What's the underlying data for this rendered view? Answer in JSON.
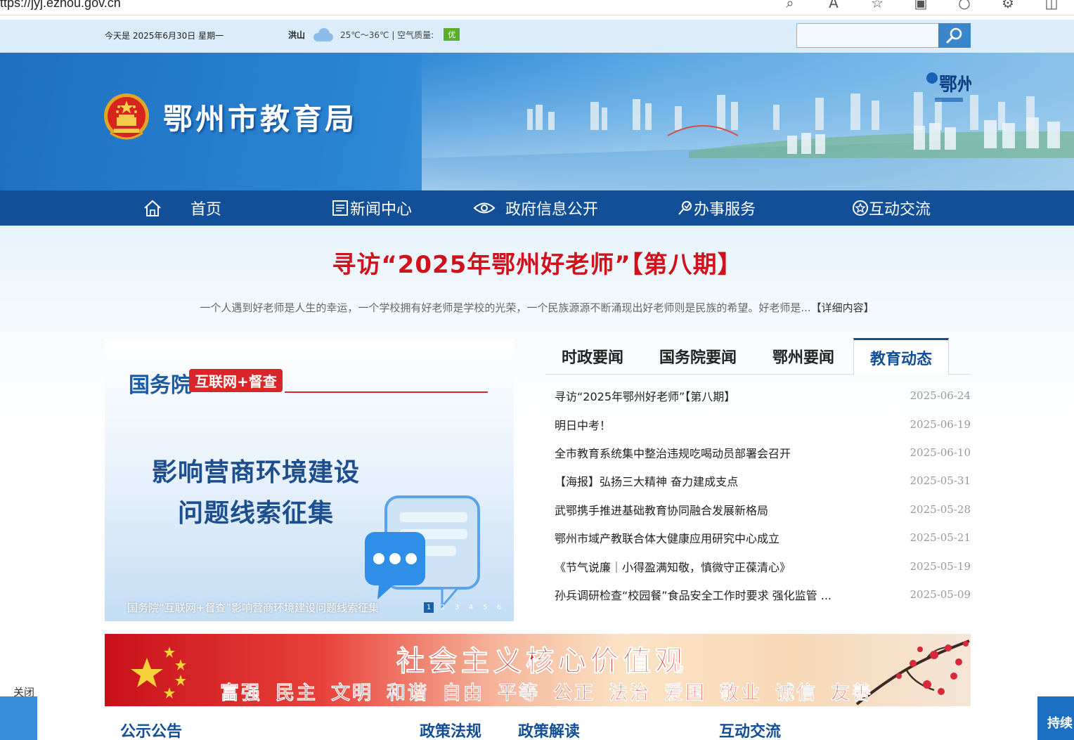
{
  "browser": {
    "url": "ttps://jyj.ezhou.gov.cn"
  },
  "topbar": {
    "date": "今天是 2025年6月30日 星期一",
    "city": "洪山",
    "temperature": "25℃～36℃ | 空气质量:",
    "air_quality": "优",
    "search_placeholder": ""
  },
  "header": {
    "site_title": "鄂州市教育局",
    "corner_logo_text": "鄂州"
  },
  "nav": {
    "items": [
      {
        "label": "首页",
        "icon": "home-icon"
      },
      {
        "label": "新闻中心",
        "icon": "newspaper-icon"
      },
      {
        "label": "政府信息公开",
        "icon": "eye-icon"
      },
      {
        "label": "办事服务",
        "icon": "service-icon"
      },
      {
        "label": "互动交流",
        "icon": "star-circle-icon"
      }
    ]
  },
  "feature": {
    "headline": "寻访“2025年鄂州好老师”【第八期】",
    "summary": "一个人遇到好老师是人生的幸运，一个学校拥有好老师是学校的光荣，一个民族源源不断涌现出好老师则是民族的希望。好老师是...",
    "detail_link": "【详细内容】"
  },
  "slider": {
    "org": "国务院",
    "tag": "互联网+督查",
    "title_line1": "影响营商环境建设",
    "title_line2": "问题线索征集",
    "caption": "国务院“互联网+督查”影响营商环境建设问题线索征集",
    "pages": [
      "1",
      "2",
      "3",
      "4",
      "5",
      "6"
    ],
    "active_page": 1
  },
  "news": {
    "tabs": [
      "时政要闻",
      "国务院要闻",
      "鄂州要闻",
      "教育动态"
    ],
    "active_tab": "教育动态",
    "items": [
      {
        "title": "寻访“2025年鄂州好老师”【第八期】",
        "date": "2025-06-24"
      },
      {
        "title": "明日中考！",
        "date": "2025-06-19"
      },
      {
        "title": "全市教育系统集中整治违规吃喝动员部署会召开",
        "date": "2025-06-10"
      },
      {
        "title": "【海报】弘扬三大精神 奋力建成支点",
        "date": "2025-05-31"
      },
      {
        "title": "武鄂携手推进基础教育协同融合发展新格局",
        "date": "2025-05-28"
      },
      {
        "title": "鄂州市域产教联合体大健康应用研究中心成立",
        "date": "2025-05-21"
      },
      {
        "title": "《节气说廉｜小得盈满知敬，慎微守正葆清心》",
        "date": "2025-05-19"
      },
      {
        "title": "孙兵调研检查“校园餐”食品安全工作时要求 强化监管 ...",
        "date": "2025-05-09"
      }
    ]
  },
  "values_banner": {
    "title": "社会主义核心价值观",
    "words": [
      "富强",
      "民主",
      "文明",
      "和谐",
      "自由",
      "平等",
      "公正",
      "法治",
      "爱国",
      "敬业",
      "诚信",
      "友善"
    ]
  },
  "bottom": {
    "headings": [
      "公示公告",
      "政策法规",
      "政策解读",
      "互动交流"
    ]
  },
  "floaters": {
    "close_label": "关闭",
    "right_label": "持续"
  },
  "colors": {
    "nav_bg": "#134f97",
    "headline_red": "#d0121b",
    "topbar_bg": "#dbecfa",
    "air_quality_green": "#5cae2a"
  }
}
